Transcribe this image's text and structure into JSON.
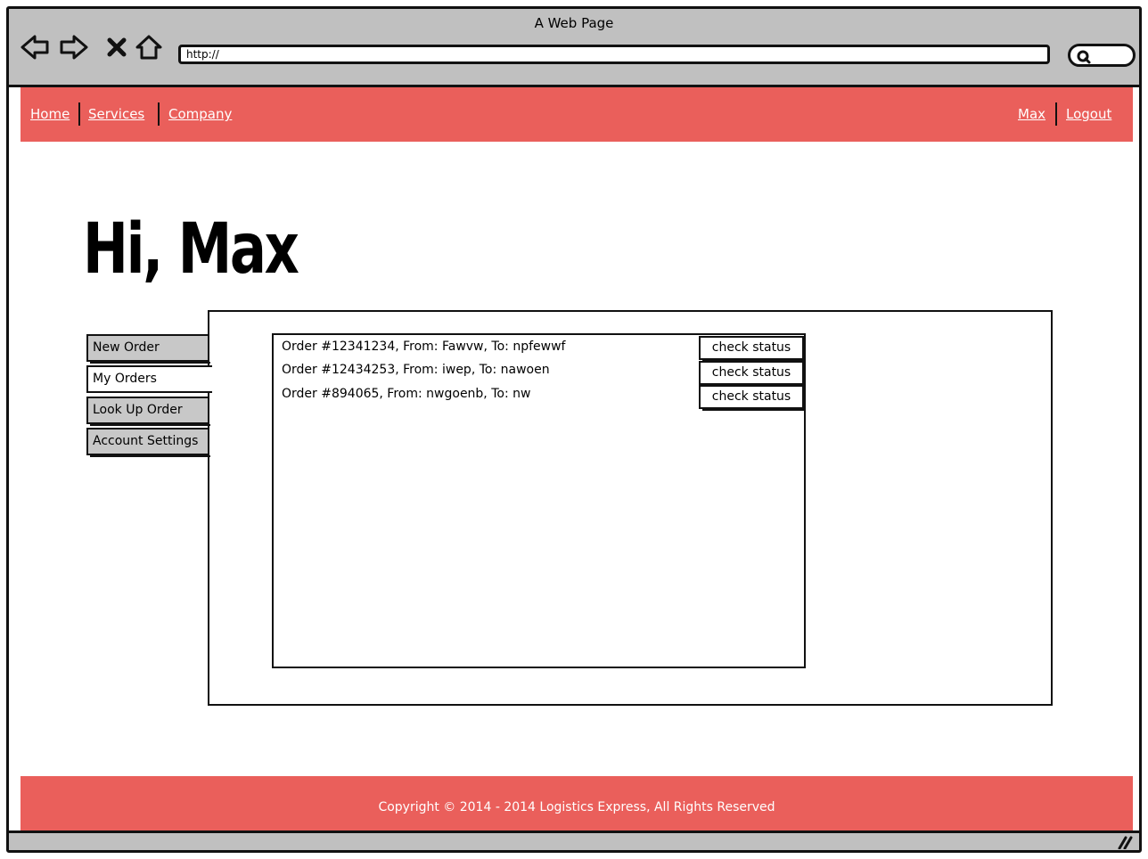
{
  "window": {
    "title": "A Web Page"
  },
  "browser": {
    "url_value": "http://"
  },
  "nav": {
    "left": [
      "Home",
      "Services",
      "Company"
    ],
    "right": [
      "Max",
      "Logout"
    ]
  },
  "greeting": "Hi, Max",
  "tabs": [
    {
      "label": "New Order",
      "active": false
    },
    {
      "label": "My Orders",
      "active": true
    },
    {
      "label": "Look Up Order",
      "active": false
    },
    {
      "label": "Account Settings",
      "active": false
    }
  ],
  "orders": [
    {
      "text": "Order #12341234, From: Fawvw,  To: npfewwf",
      "button": "check status"
    },
    {
      "text": "Order #12434253, From: iwep, To: nawoen",
      "button": "check status"
    },
    {
      "text": "Order #894065, From: nwgoenb, To: nw",
      "button": "check status"
    }
  ],
  "footer": {
    "copyright": "Copyright © 2014 - 2014 Logistics Express, All Rights Reserved"
  },
  "colors": {
    "accent": "#ea5f5b",
    "chrome": "#c0c0c0"
  }
}
